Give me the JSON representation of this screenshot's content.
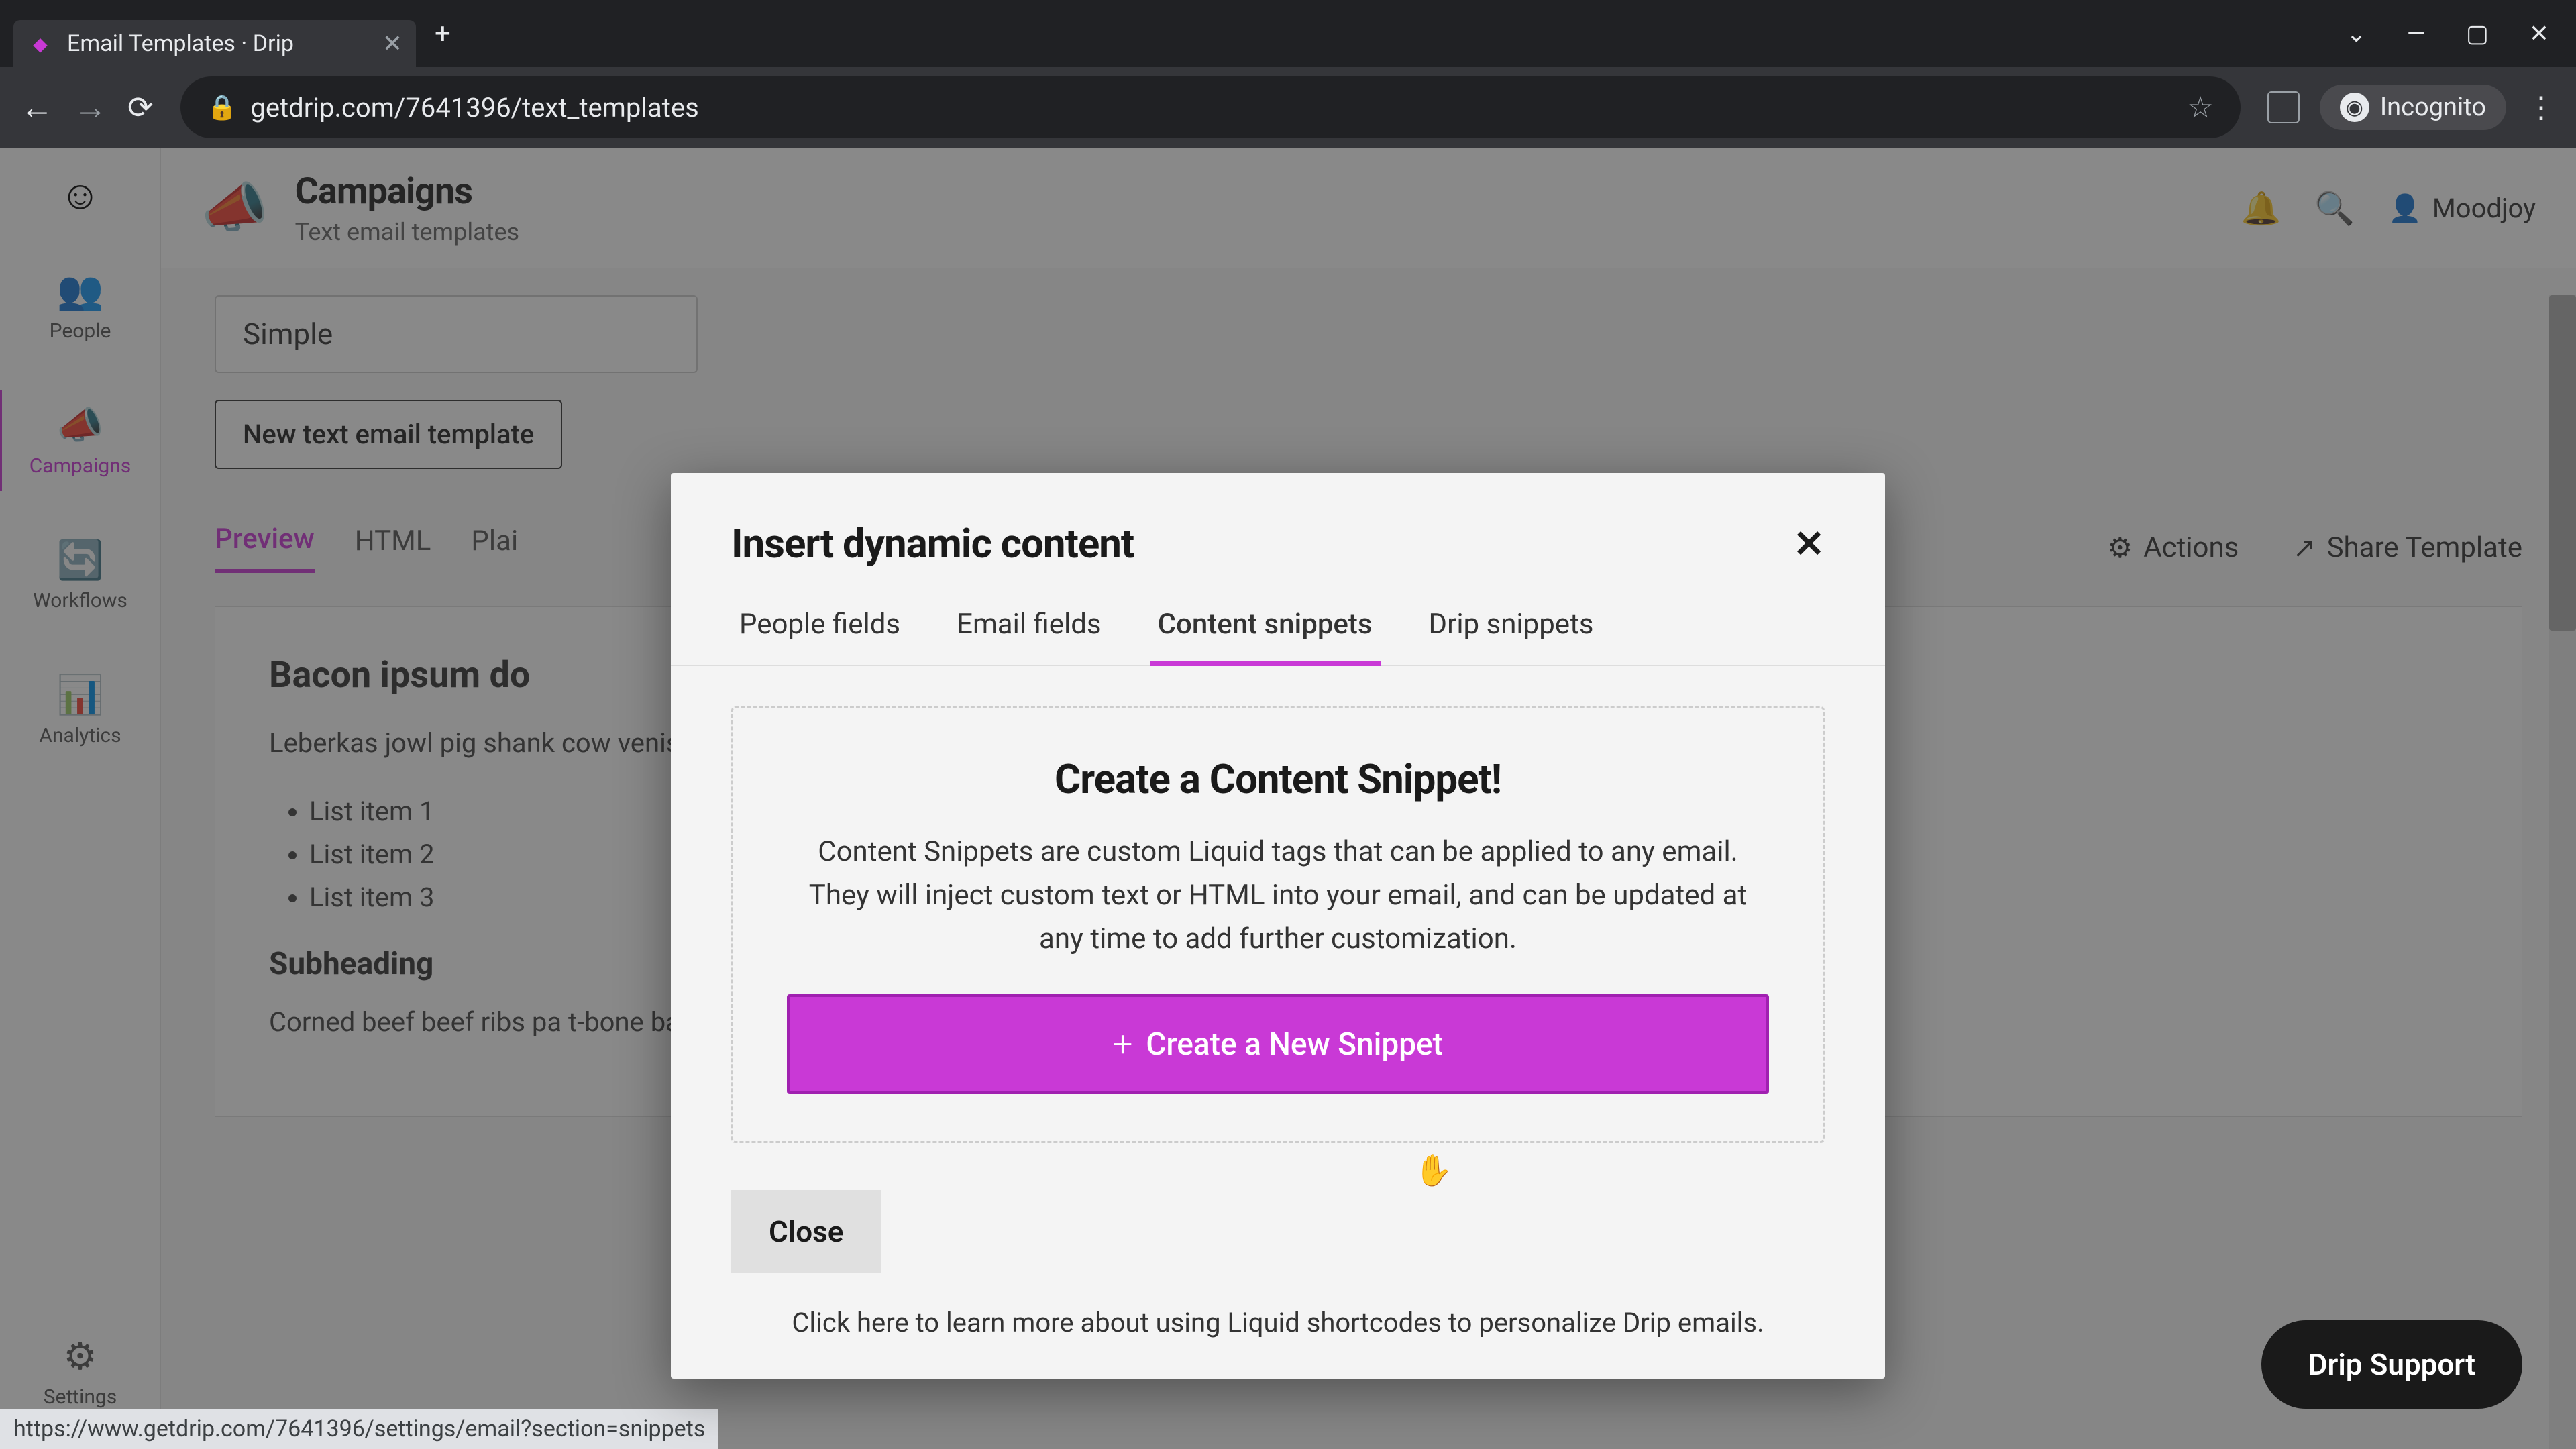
{
  "browser": {
    "tab_title": "Email Templates · Drip",
    "url": "getdrip.com/7641396/text_templates",
    "incognito_label": "Incognito",
    "window_controls": {
      "min": "—",
      "max": "▢",
      "close": "✕"
    },
    "status_url": "https://www.getdrip.com/7641396/settings/email?section=snippets"
  },
  "sidebar": {
    "items": [
      {
        "icon": "👥",
        "label": "People"
      },
      {
        "icon": "📣",
        "label": "Campaigns"
      },
      {
        "icon": "🔄",
        "label": "Workflows"
      },
      {
        "icon": "📊",
        "label": "Analytics"
      }
    ],
    "settings": {
      "icon": "⚙",
      "label": "Settings"
    }
  },
  "header": {
    "icon": "📣",
    "title": "Campaigns",
    "subtitle": "Text email templates",
    "user": "Moodjoy"
  },
  "main": {
    "template_name": "Simple",
    "new_template_btn": "New text email template",
    "tabs": [
      "Preview",
      "HTML",
      "Plai"
    ],
    "actions": {
      "actions": "Actions",
      "share": "Share Template"
    },
    "preview": {
      "heading": "Bacon ipsum do",
      "paragraph": "Leberkas jowl pig shank cow venison. Frankfurter ham andouille pork belly mignon sausage.",
      "list": [
        "List item 1",
        "List item 2",
        "List item 3"
      ],
      "subheading": "Subheading",
      "paragraph2": "Corned beef beef ribs pa t-bone bacon. Beef chuck hamburger, bacon cow venison fatback shoulder jowl"
    }
  },
  "modal": {
    "title": "Insert dynamic content",
    "tabs": [
      "People fields",
      "Email fields",
      "Content snippets",
      "Drip snippets"
    ],
    "active_tab": 2,
    "snippet": {
      "heading": "Create a Content Snippet!",
      "description": "Content Snippets are custom Liquid tags that can be applied to any email. They will inject custom text or HTML into your email, and can be updated at any time to add further customization.",
      "create_btn": "Create a New Snippet"
    },
    "close_btn": "Close",
    "learn_more_prefix": "Click ",
    "learn_more_link": "here",
    "learn_more_suffix": " to learn more about using Liquid shortcodes to personalize Drip emails."
  },
  "support_pill": "Drip Support",
  "colors": {
    "accent": "#c939d6"
  }
}
